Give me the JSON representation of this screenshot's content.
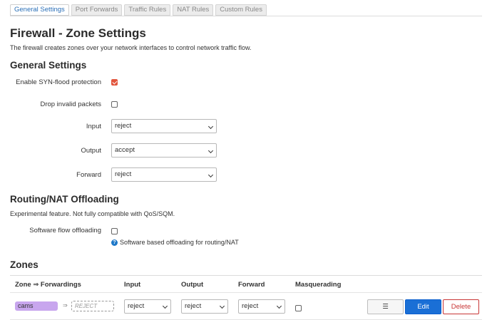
{
  "tabs": [
    {
      "label": "General Settings"
    },
    {
      "label": "Port Forwards"
    },
    {
      "label": "Traffic Rules"
    },
    {
      "label": "NAT Rules"
    },
    {
      "label": "Custom Rules"
    }
  ],
  "page": {
    "title": "Firewall - Zone Settings",
    "description": "The firewall creates zones over your network interfaces to control network traffic flow."
  },
  "general": {
    "heading": "General Settings",
    "syn_label": "Enable SYN-flood protection",
    "syn_checked": true,
    "drop_label": "Drop invalid packets",
    "drop_checked": false,
    "input_label": "Input",
    "input_value": "reject",
    "output_label": "Output",
    "output_value": "accept",
    "forward_label": "Forward",
    "forward_value": "reject"
  },
  "offload": {
    "heading": "Routing/NAT Offloading",
    "description": "Experimental feature. Not fully compatible with QoS/SQM.",
    "sfo_label": "Software flow offloading",
    "sfo_checked": false,
    "hint": "Software based offloading for routing/NAT",
    "hint_icon": "question-icon"
  },
  "zones": {
    "heading": "Zones",
    "columns": [
      "Zone ⇒ Forwardings",
      "Input",
      "Output",
      "Forward",
      "Masquerading"
    ],
    "rows": [
      {
        "zone": "cams",
        "zone_color": "#c8a6ee",
        "arrow": "⇒",
        "dest": "REJECT",
        "input": "reject",
        "output": "reject",
        "forward": "reject",
        "masq": false
      }
    ],
    "menu_label": "☰",
    "edit_label": "Edit",
    "delete_label": "Delete"
  },
  "colors": {
    "accent": "#1a6fd6",
    "checkbox_on": "#e2553d",
    "danger": "#c83535"
  }
}
